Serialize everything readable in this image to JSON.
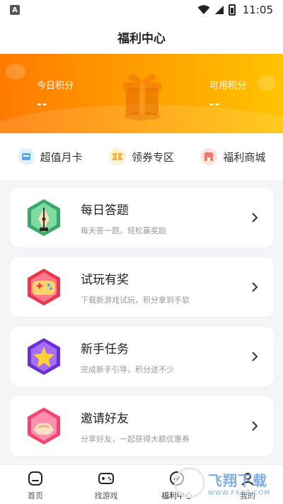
{
  "status_bar": {
    "time": "11:05",
    "app_badge": "A"
  },
  "header": {
    "title": "福利中心"
  },
  "banner": {
    "today_points_label": "今日积分",
    "today_points_value": "--",
    "available_points_label": "可用积分",
    "available_points_value": "--"
  },
  "quick_links": [
    {
      "label": "超值月卡",
      "icon": "month-card-icon",
      "color": "#5aa7e8"
    },
    {
      "label": "领券专区",
      "icon": "coupon-icon",
      "color": "#f2b43a"
    },
    {
      "label": "福利商城",
      "icon": "shop-icon",
      "color": "#f07a6a"
    }
  ],
  "tasks": [
    {
      "title": "每日答题",
      "subtitle": "每天答一题，轻松赢奖励",
      "icon": "pen-icon",
      "color": "#4fc17b"
    },
    {
      "title": "试玩有奖",
      "subtitle": "下载新游戏试玩，积分拿到手软",
      "icon": "gamepad-icon",
      "color": "#ff5a6e"
    },
    {
      "title": "新手任务",
      "subtitle": "完成新手引导，积分送不少",
      "icon": "star-icon",
      "color": "#8a4df0"
    },
    {
      "title": "邀请好友",
      "subtitle": "分享好友，一起获得大额优惠券",
      "icon": "handshake-icon",
      "color": "#ff6b8a"
    }
  ],
  "bottom_nav": [
    {
      "label": "首页",
      "icon": "home-icon"
    },
    {
      "label": "找游戏",
      "icon": "gamepad-nav-icon"
    },
    {
      "label": "福利中心",
      "icon": "welfare-icon",
      "active": true
    },
    {
      "label": "我的",
      "icon": "profile-icon"
    }
  ],
  "watermark": {
    "main": "飞翔下载",
    "sub": "WWW.FXXZ.COM"
  }
}
